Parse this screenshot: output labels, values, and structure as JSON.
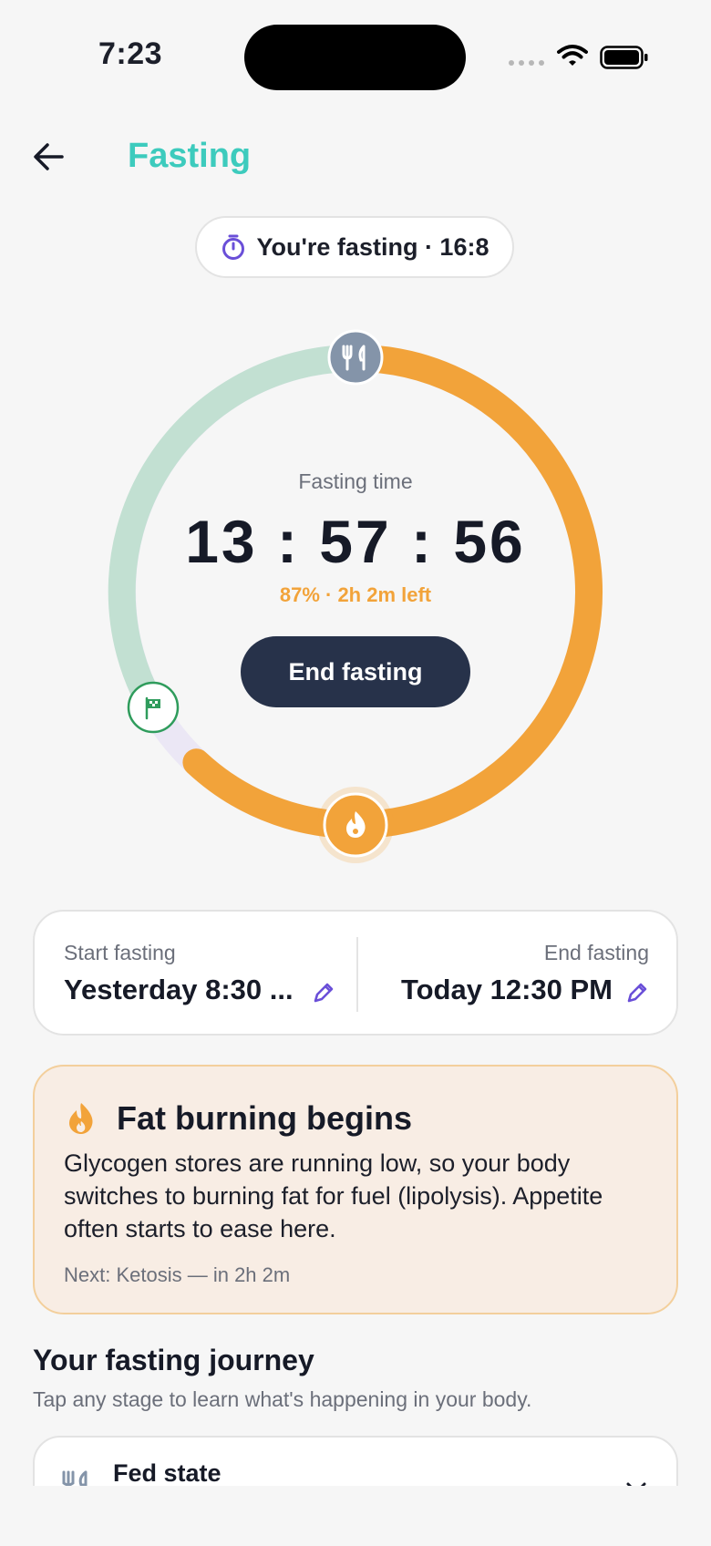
{
  "status_bar": {
    "time": "7:23"
  },
  "header": {
    "title": "Fasting"
  },
  "status_pill": {
    "text": "You're fasting · 16:8"
  },
  "timer": {
    "label": "Fasting time",
    "value": "13 : 57 : 56",
    "progress_text": "87% · 2h 2m left",
    "progress_fraction": 0.87,
    "end_button": "End fasting"
  },
  "colors": {
    "accent_teal": "#3dcbbd",
    "ring_orange": "#f2a33a",
    "ring_mint": "#c2e0d2",
    "ring_lavender": "#ebe7f5",
    "button_dark": "#27324a",
    "edit_purple": "#6a4fd8",
    "flag_green": "#2f9c5c"
  },
  "schedule": {
    "start_label": "Start fasting",
    "start_value": "Yesterday 8:30 ...",
    "end_label": "End fasting",
    "end_value": "Today 12:30 PM"
  },
  "current_stage": {
    "icon": "flame-icon",
    "title": "Fat burning begins",
    "body": "Glycogen stores are running low, so your body switches to burning fat for fuel (lipolysis). Appetite often starts to ease here.",
    "next": "Next: Ketosis — in 2h 2m"
  },
  "journey": {
    "title": "Your fasting journey",
    "subtitle": "Tap any stage to learn what's happening in your body.",
    "stages": [
      {
        "icon": "fork-knife-icon",
        "title": "Fed state"
      }
    ]
  }
}
